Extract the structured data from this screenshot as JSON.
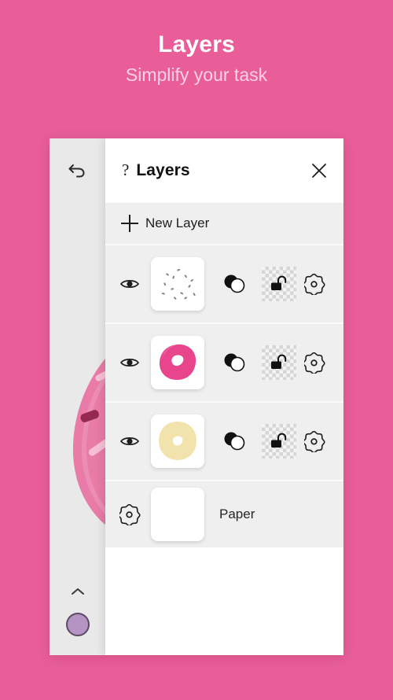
{
  "promo": {
    "title": "Layers",
    "subtitle": "Simplify your task",
    "background_color": "#e95e99",
    "title_color": "#ffffff",
    "subtitle_color": "#fbd2e3"
  },
  "toolstrip": {
    "undo_icon": "undo-arrow-icon",
    "expand_icon": "chevron-up-icon",
    "color_swatch": {
      "name": "color-swatch",
      "color": "#b594c4",
      "border_color": "#5c4a64"
    },
    "background_color": "#e9e9e9"
  },
  "canvas": {
    "artwork": "pink-donut-with-sprinkles",
    "donut_color": "#e87ba7",
    "donut_shadow_color": "#d96d9b",
    "sprinkle_colors": [
      "#f9c6d8",
      "#ffffff",
      "#8e2248"
    ]
  },
  "panel": {
    "header": {
      "help_icon": "question-mark-icon",
      "title": "Layers",
      "close_icon": "close-x-icon"
    },
    "new_layer": {
      "icon": "plus-icon",
      "label": "New Layer"
    },
    "column_icons": {
      "visibility": "eye-icon",
      "blend_mode": "overlapping-circles-icon",
      "lock": "open-padlock-icon",
      "settings": "gear-icon"
    },
    "layers": [
      {
        "name": "sprinkles-layer",
        "visible": true,
        "visibility_icon": "eye-icon",
        "thumbnail": "sprinkles-thumbnail",
        "blend_icon": "overlapping-circles-icon",
        "lock_icon": "open-padlock-icon",
        "locked": false,
        "settings_icon": "gear-icon"
      },
      {
        "name": "pink-frosting-layer",
        "visible": true,
        "visibility_icon": "eye-icon",
        "thumbnail": "pink-donut-thumbnail",
        "blend_icon": "overlapping-circles-icon",
        "lock_icon": "open-padlock-icon",
        "locked": false,
        "settings_icon": "gear-icon"
      },
      {
        "name": "dough-base-layer",
        "visible": true,
        "visibility_icon": "eye-icon",
        "thumbnail": "cream-donut-thumbnail",
        "blend_icon": "overlapping-circles-icon",
        "lock_icon": "open-padlock-icon",
        "locked": false,
        "settings_icon": "gear-icon"
      }
    ],
    "paper": {
      "settings_icon": "gear-icon",
      "thumbnail": "white-paper-thumbnail",
      "label": "Paper"
    }
  }
}
